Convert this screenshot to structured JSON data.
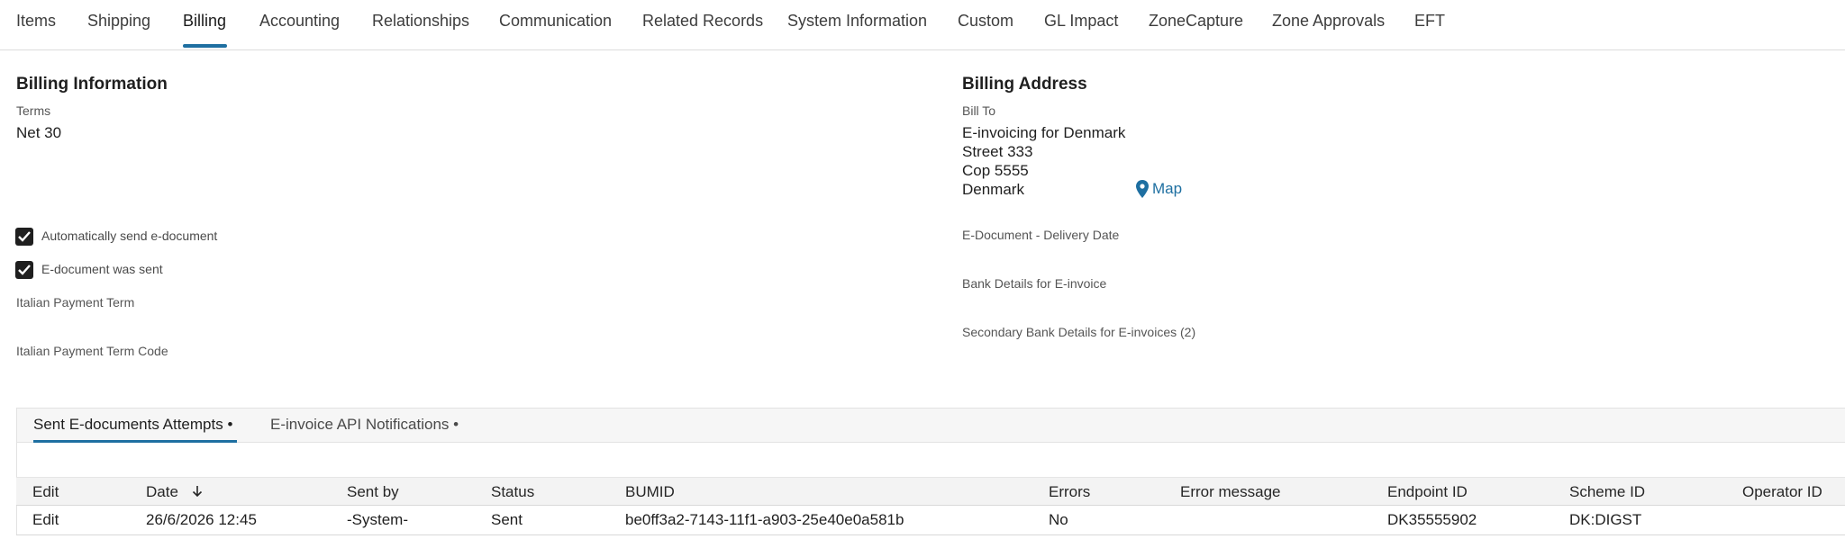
{
  "tabs": [
    "Items",
    "Shipping",
    "Billing",
    "Accounting",
    "Relationships",
    "Communication",
    "Related Records",
    "System Information",
    "Custom",
    "GL Impact",
    "ZoneCapture",
    "Zone Approvals",
    "EFT"
  ],
  "active_tab": "Billing",
  "billing_info": {
    "title": "Billing Information",
    "terms_label": "Terms",
    "terms_value": "Net 30",
    "auto_send_label": "Automatically send e-document",
    "auto_send_checked": true,
    "was_sent_label": "E-document was sent",
    "was_sent_checked": true,
    "italian_payment_term_label": "Italian Payment Term",
    "italian_payment_term_code_label": "Italian Payment Term Code"
  },
  "billing_address": {
    "title": "Billing Address",
    "bill_to_label": "Bill To",
    "lines": [
      "E-invoicing for Denmark",
      "Street 333",
      "Cop 5555",
      "Denmark"
    ],
    "map_link": "Map",
    "delivery_date_label": "E-Document - Delivery Date",
    "bank_details_label": "Bank Details for E-invoice",
    "secondary_bank_label": "Secondary Bank Details for E-invoices (2)"
  },
  "sublist": {
    "tabs": [
      "Sent E-documents Attempts •",
      "E-invoice API Notifications •"
    ],
    "columns": [
      "Edit",
      "Date",
      "Sent by",
      "Status",
      "BUMID",
      "Errors",
      "Error message",
      "Endpoint ID",
      "Scheme ID",
      "Operator ID"
    ],
    "rows": [
      {
        "edit": "Edit",
        "date": "26/6/2026 12:45",
        "sent_by": "-System-",
        "status": "Sent",
        "bumid": "be0ff3a2-7143-11f1-a903-25e40e0a581b",
        "errors": "No",
        "error_message": "",
        "endpoint_id": "DK35555902",
        "scheme_id": "DK:DIGST",
        "operator_id": ""
      }
    ]
  },
  "colors": {
    "accent": "#1e6fa1",
    "text": "#1f1f1f",
    "muted": "#555555"
  }
}
